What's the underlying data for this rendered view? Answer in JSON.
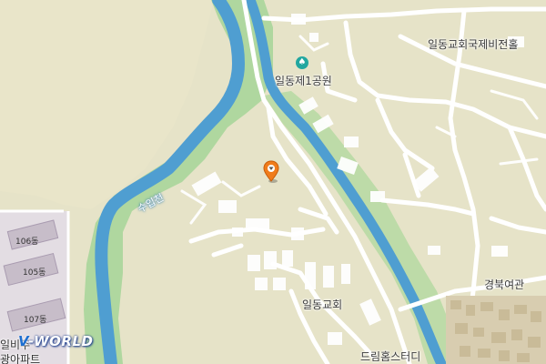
{
  "map": {
    "labels": {
      "park": "일동제1공원",
      "memorial_hall": "일동교회국제비전홀",
      "river": "수입천",
      "church": "일동교회",
      "girls_hall": "경북여관",
      "studio": "드림홈스터디",
      "apt_106": "106동",
      "apt_105": "105동",
      "apt_107": "107동",
      "apt_name": "일비주",
      "apt_name2": "광아파트"
    },
    "icons": {
      "park_icon": "park-icon",
      "location_marker": "map-pin-icon"
    },
    "colors": {
      "land": "#e6e3c8",
      "river_water": "#4f9ed1",
      "river_bank": "#a9d59a",
      "road": "#ffffff",
      "marker": "#f07c1b",
      "park_icon": "#22a7a0"
    },
    "watermark": {
      "prefix": "V",
      "suffix": "-WORLD"
    }
  }
}
